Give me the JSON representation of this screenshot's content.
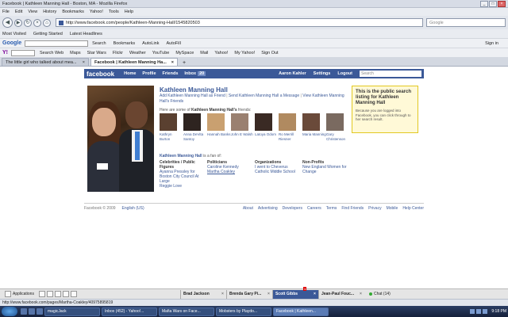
{
  "window": {
    "title": "Facebook | Kathleen Manning Hall - Boston, MA - Mozilla Firefox"
  },
  "menu": [
    "File",
    "Edit",
    "View",
    "History",
    "Bookmarks",
    "Yahoo!",
    "Tools",
    "Help"
  ],
  "nav": {
    "url": "http://www.facebook.com/people/Kathleen-Manning-Hall/1545820503",
    "search_placeholder": "Google"
  },
  "bookmarks": [
    "Most Visited",
    "Getting Started",
    "Latest Headlines"
  ],
  "google_toolbar": {
    "logo": "Google",
    "items": [
      "Search",
      "Bookmarks",
      "AutoLink",
      "AutoFill",
      "Sign in"
    ]
  },
  "yahoo_toolbar": {
    "logo": "Y!",
    "items": [
      "Search Web",
      "Maps",
      "Star Wars",
      "Flickr",
      "Weather",
      "YouTube",
      "MySpace",
      "Mail",
      "Yahoo!",
      "My Yahoo!",
      "Sign Out"
    ]
  },
  "tabs": [
    {
      "label": "The little girl who talked about mea...",
      "active": false
    },
    {
      "label": "Facebook | Kathleen Manning Ha...",
      "active": true
    }
  ],
  "fb_header": {
    "logo": "facebook",
    "links": [
      "Home",
      "Profile",
      "Friends",
      "Inbox"
    ],
    "inbox_count": "20",
    "user": "Aaron Kahler",
    "settings": "Settings",
    "logout": "Logout",
    "search_placeholder": "Search"
  },
  "profile": {
    "name": "Kathleen Manning Hall",
    "action_add": "Add Kathleen Manning Hall as Friend",
    "action_message": "Send Kathleen Manning Hall a Message",
    "action_view": "View Kathleen Manning Hall's Friends",
    "friends_prefix": "Here are some of",
    "friends_owner": "Kathleen Manning Hall's",
    "friends_suffix": "friends:",
    "friends": [
      {
        "name": "Kathryn Burton",
        "color": "#5a4030"
      },
      {
        "name": "Anna DeVita Santoy",
        "color": "#2e2420"
      },
      {
        "name": "Hannah Banks",
        "color": "#c9a070"
      },
      {
        "name": "John E Walsh",
        "color": "#9a8070"
      },
      {
        "name": "Latoya Odom",
        "color": "#3a2a24"
      },
      {
        "name": "Ro Merrill Riesner",
        "color": "#b08a60"
      },
      {
        "name": "Maria Manning",
        "color": "#6a4a3a"
      },
      {
        "name": "Gary Christenson",
        "color": "#7a6a60"
      }
    ],
    "fan_owner": "Kathleen Manning Hall",
    "fan_suffix": "is a fan of:",
    "fan_categories": [
      {
        "heading": "Celebrities / Public Figures",
        "items": [
          "Ayanna Pressley for Boston City Council At Large",
          "Reggie Love"
        ]
      },
      {
        "heading": "Politicians",
        "items": [
          "Caroline Kennedy",
          "Martha Coakley"
        ]
      },
      {
        "heading": "Organizations",
        "items": [
          "I went to Cheverus Catholic Middle School"
        ]
      },
      {
        "heading": "Non-Profits",
        "items": [
          "New England Women for Change"
        ]
      }
    ]
  },
  "infobox": {
    "heading": "This is the public search listing for Kathleen Manning Hall",
    "body": "Because you are logged into Facebook, you can click through to her search result."
  },
  "footer": {
    "copyright": "Facebook © 2009",
    "language": "English (US)",
    "links": [
      "About",
      "Advertising",
      "Developers",
      "Careers",
      "Terms",
      "Find Friends",
      "Privacy",
      "Mobile",
      "Help Center"
    ]
  },
  "chatbar": {
    "applications": "Applications",
    "chats": [
      {
        "name": "Brad Jackson",
        "active": false,
        "notify": ""
      },
      {
        "name": "Brenda Gary Pi...",
        "active": false,
        "notify": ""
      },
      {
        "name": "Scott Gibbs",
        "active": true,
        "notify": "1"
      },
      {
        "name": "Jean-Paul Fouc...",
        "active": false,
        "notify": ""
      }
    ],
    "chat_label": "Chat (14)"
  },
  "statusbar": {
    "text": "http://www.facebook.com/pages/Martha-Coakley/40975895819"
  },
  "taskbar": {
    "tasks": [
      {
        "label": "magicJack",
        "active": false
      },
      {
        "label": "Inbox (452) - Yahoo!...",
        "active": false
      },
      {
        "label": "Mafia Wars on Face...",
        "active": false
      },
      {
        "label": "Mobsters by Playdo...",
        "active": false
      },
      {
        "label": "Facebook | Kathleen...",
        "active": true
      }
    ],
    "clock": "9:18 PM"
  }
}
